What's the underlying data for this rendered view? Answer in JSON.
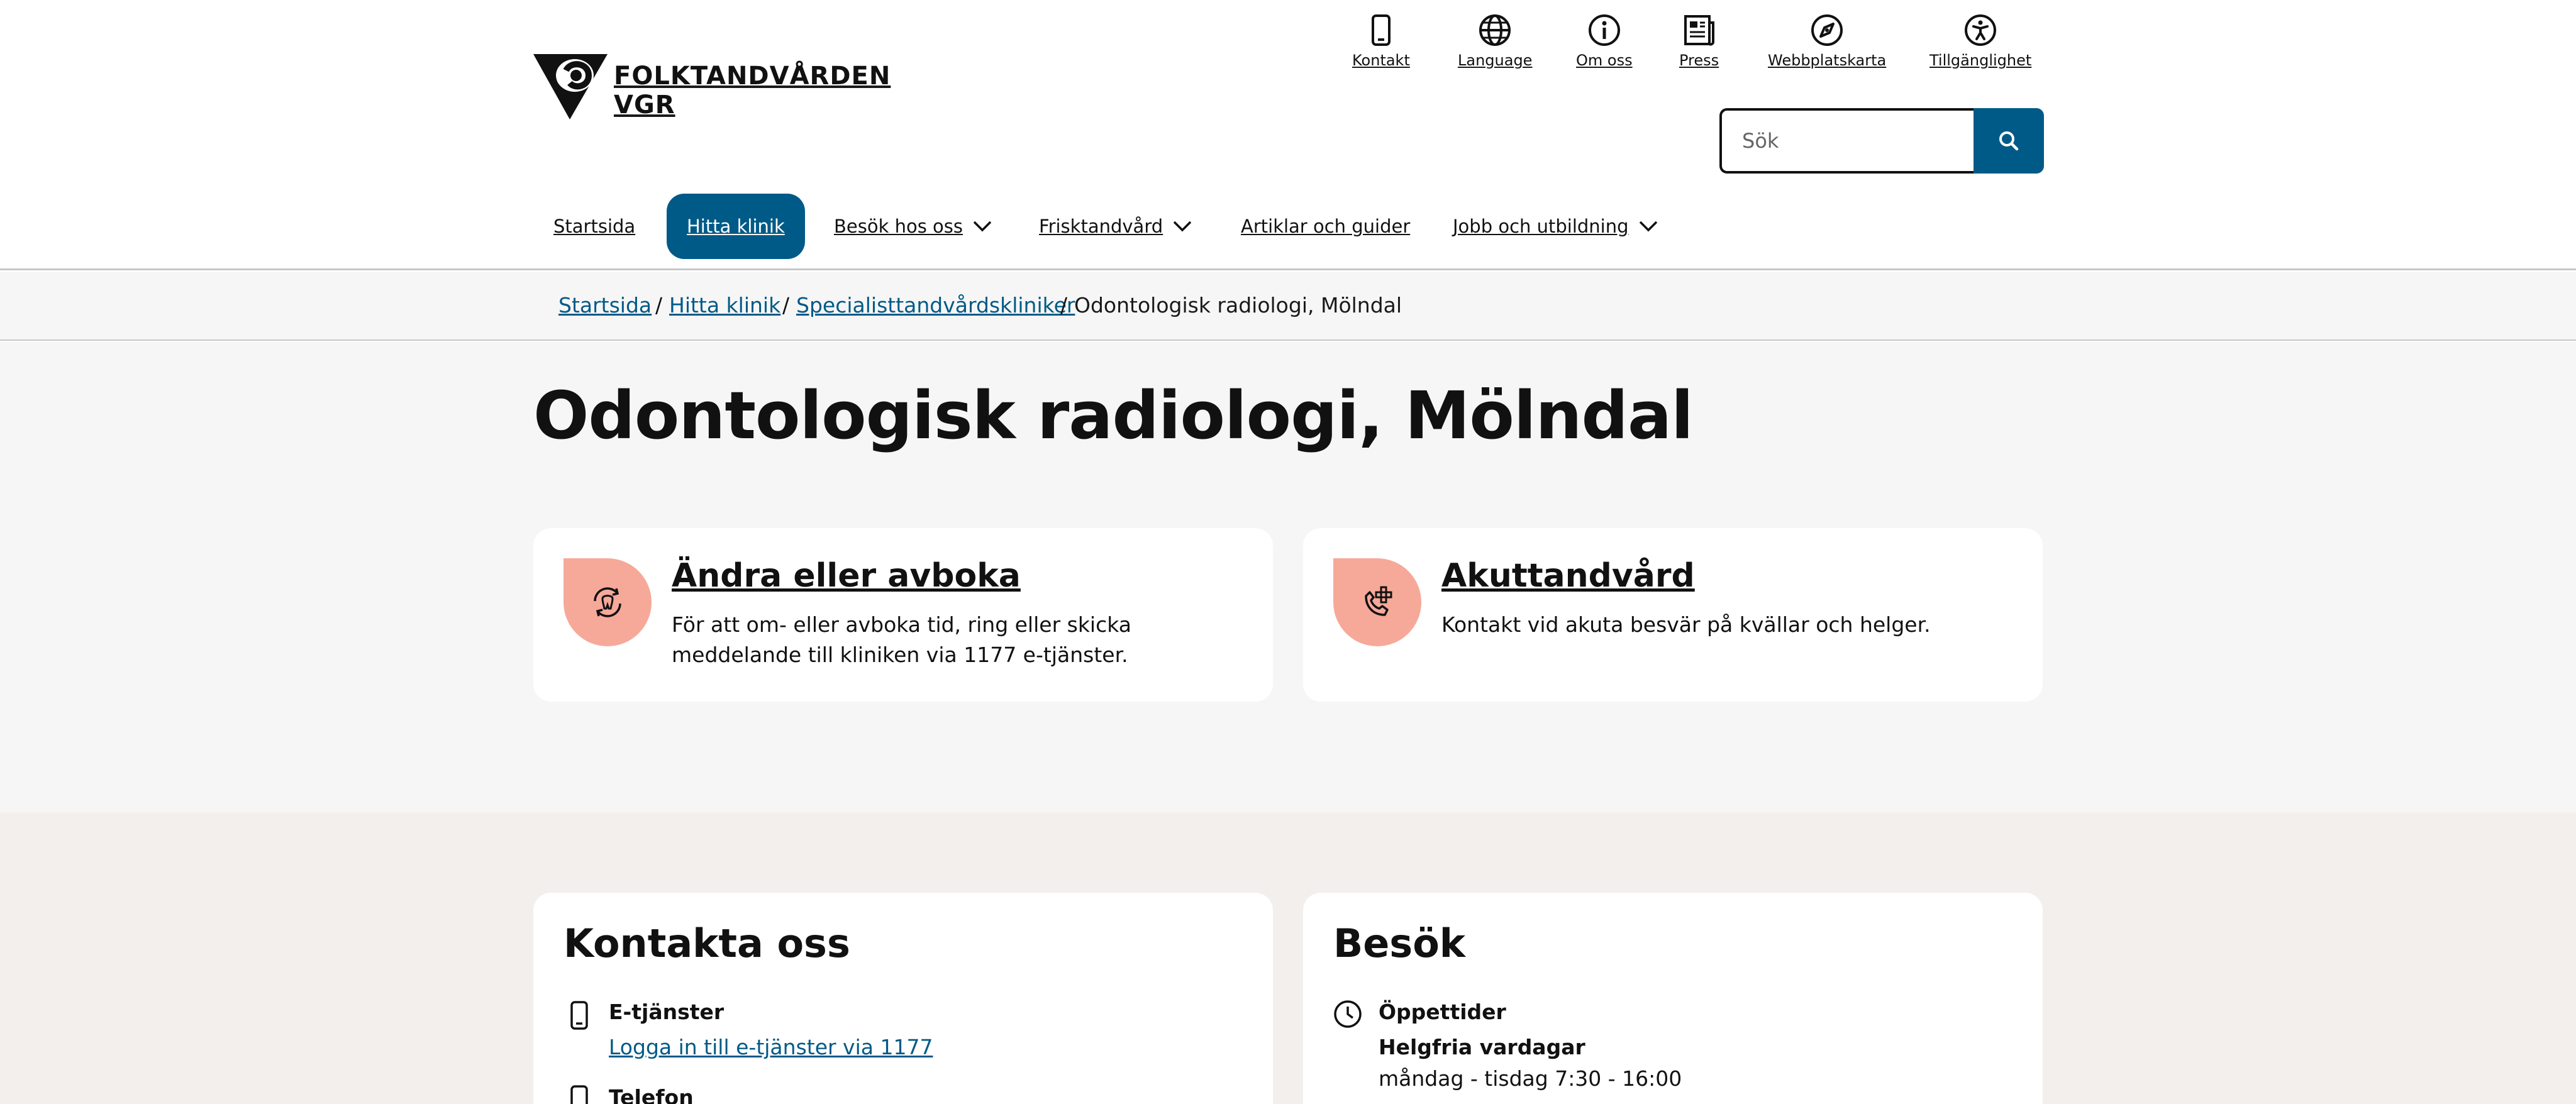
{
  "brand": {
    "line1": "FOLKTANDVÅRDEN",
    "line2": "VGR"
  },
  "utility_nav": [
    {
      "label": "Kontakt",
      "icon": "phone-icon"
    },
    {
      "label": "Language",
      "icon": "globe-icon"
    },
    {
      "label": "Om oss",
      "icon": "info-icon"
    },
    {
      "label": "Press",
      "icon": "newspaper-icon"
    },
    {
      "label": "Webbplatskarta",
      "icon": "compass-icon"
    },
    {
      "label": "Tillgänglighet",
      "icon": "accessibility-icon"
    }
  ],
  "search": {
    "placeholder": "Sök",
    "button_icon": "search-icon"
  },
  "main_nav": [
    {
      "label": "Startsida",
      "dropdown": false,
      "active": false
    },
    {
      "label": "Hitta klinik",
      "dropdown": false,
      "active": true
    },
    {
      "label": "Besök hos oss",
      "dropdown": true,
      "active": false
    },
    {
      "label": "Frisktandvård",
      "dropdown": true,
      "active": false
    },
    {
      "label": "Artiklar och guider",
      "dropdown": false,
      "active": false
    },
    {
      "label": "Jobb och utbildning",
      "dropdown": true,
      "active": false
    }
  ],
  "breadcrumb": [
    {
      "label": "Startsida",
      "link": true
    },
    {
      "label": "Hitta klinik",
      "link": true
    },
    {
      "label": "Specialisttandvårdskliniker",
      "link": true
    },
    {
      "label": "Odontologisk radiologi, Mölndal",
      "link": false
    }
  ],
  "page_title": "Odontologisk radiologi, Mölndal",
  "cards": [
    {
      "title": "Ändra eller avboka",
      "text": "För att om- eller avboka tid, ring eller skicka meddelande till kliniken via 1177 e-tjänster.",
      "icon": "tooth-refresh-icon"
    },
    {
      "title": "Akuttandvård",
      "text": "Kontakt vid akuta besvär på kvällar och helger.",
      "icon": "phone-plus-icon"
    }
  ],
  "contact": {
    "title": "Kontakta oss",
    "etjanster_label": "E-tjänster",
    "etjanster_link": "Logga in till e-tjänster via 1177",
    "phone_label": "Telefon"
  },
  "visit": {
    "title": "Besök",
    "hours_label": "Öppettider",
    "weekday_label": "Helgfria vardagar",
    "weekday_hours": "måndag - tisdag 7:30 - 16:00"
  },
  "colors": {
    "primary": "#005a87",
    "accent": "#f6a999",
    "hero_bg": "#f6f6f6",
    "lower_bg": "#f3efec"
  }
}
